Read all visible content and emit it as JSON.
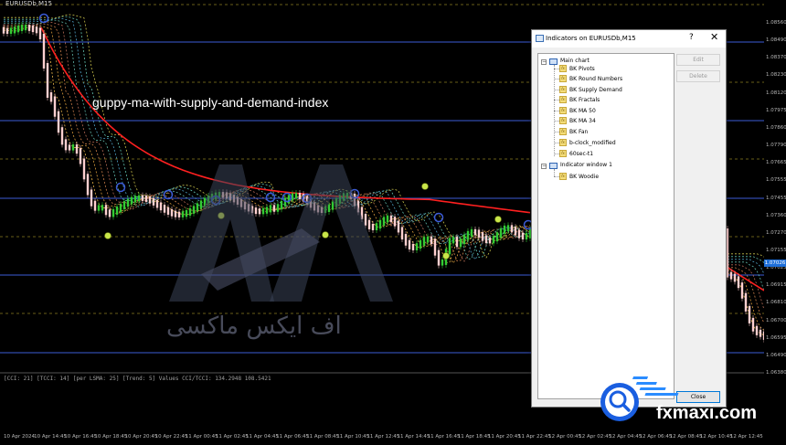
{
  "chart": {
    "symbol": "EURUSDb,M15",
    "overlay_title": "guppy-ma-with-supply-and-demand-index",
    "watermark_arabic": "اف ایکس ماکسی",
    "oscillator_info": "[CCI: 21] [TCCI: 14] [per LSMA: 25] [Trend: 5] Values CCI/TCCI: 134.2948 108.5421",
    "current_price": "1.07026",
    "price_ticks": [
      "1.08560",
      "1.08490",
      "1.08370",
      "1.08230",
      "1.08120",
      "1.07975",
      "1.07860",
      "1.07790",
      "1.07665",
      "1.07555",
      "1.07455",
      "1.07360",
      "1.07270",
      "1.07155",
      "1.07025",
      "1.06915",
      "1.06810",
      "1.06700",
      "1.06595",
      "1.06490",
      "1.06380"
    ],
    "time_ticks": [
      "10 Apr 2024",
      "10 Apr 14:45",
      "10 Apr 16:45",
      "10 Apr 18:45",
      "10 Apr 20:45",
      "10 Apr 22:45",
      "11 Apr 00:45",
      "11 Apr 02:45",
      "11 Apr 04:45",
      "11 Apr 06:45",
      "11 Apr 08:45",
      "11 Apr 10:45",
      "11 Apr 12:45",
      "11 Apr 14:45",
      "11 Apr 16:45",
      "11 Apr 18:45",
      "11 Apr 20:45",
      "11 Apr 22:45",
      "12 Apr 00:45",
      "12 Apr 02:45",
      "12 Apr 04:45",
      "12 Apr 06:45",
      "12 Apr 08:45",
      "12 Apr 10:45",
      "12 Apr 12:45"
    ],
    "colors": {
      "background": "#000000",
      "bull_candle": "#33cc33",
      "bear_candle": "#ffffff",
      "red_ma": "#ff2020",
      "level_line": "#3b5bd6",
      "dashed_level": "#8a7d20"
    }
  },
  "dialog": {
    "title": "Indicators on EURUSDb,M15",
    "help_label": "?",
    "close_label": "✕",
    "groups": [
      {
        "label": "Main chart",
        "items": [
          "BK Pivots",
          "BK Round Numbers",
          "BK Supply Demand",
          "BK Fractals",
          "BK MA 50",
          "BK MA 34",
          "BK Fan",
          "b-clock_modified",
          "60sec-t1"
        ]
      },
      {
        "label": "Indicator window 1",
        "items": [
          "BK Woodie"
        ]
      }
    ],
    "buttons": {
      "edit": "Edit",
      "delete": "Delete",
      "close": "Close"
    }
  },
  "logo": {
    "text": "fxmaxi.com",
    "icon": "magnifier-icon"
  }
}
